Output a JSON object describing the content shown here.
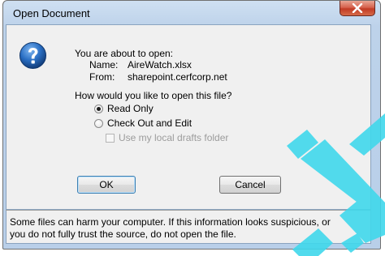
{
  "window": {
    "title": "Open Document",
    "close_icon": "close-x-icon"
  },
  "main": {
    "icon": "question-icon",
    "intro": "You are about to open:",
    "name_label": "Name:",
    "name_value": "AireWatch.xlsx",
    "from_label": "From:",
    "from_value": "sharepoint.cerfcorp.net",
    "question": "How would you like to open this file?",
    "options": [
      {
        "label": "Read Only",
        "selected": true
      },
      {
        "label": "Check Out and Edit",
        "selected": false
      }
    ],
    "drafts_checkbox": {
      "label": "Use my local drafts folder",
      "checked": false,
      "enabled": false
    }
  },
  "buttons": {
    "ok": "OK",
    "cancel": "Cancel"
  },
  "footer": {
    "line1": "Some files can harm your computer. If this information looks suspicious, or",
    "line2": "you do not fully trust the source, do not open the file."
  },
  "colors": {
    "watermark": "#40d8ec",
    "close_button": "#c23b25",
    "help_icon": "#1f5fae"
  }
}
